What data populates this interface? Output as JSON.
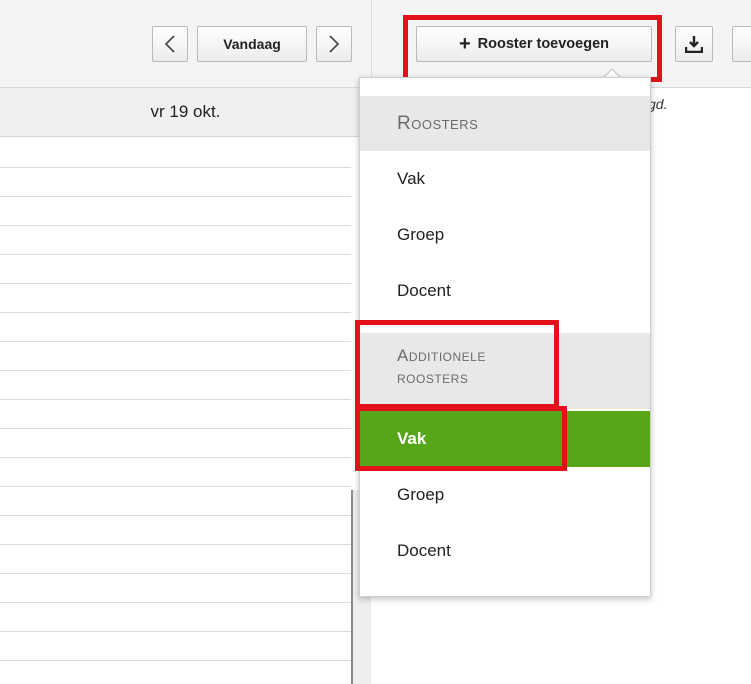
{
  "toolbar": {
    "prev_icon": "chevron-left-icon",
    "today_label": "Vandaag",
    "next_icon": "chevron-right-icon",
    "add_schedule_label": "Rooster toevoegen",
    "download_icon": "download-icon"
  },
  "calendar": {
    "day_header": "vr 19 okt.",
    "side_text_fragment": "gd."
  },
  "dropdown": {
    "section_roosters": "Roosters",
    "roosters_items": [
      "Vak",
      "Groep",
      "Docent"
    ],
    "section_additionele_line1": "Additionele",
    "section_additionele_line2": "roosters",
    "additionele_items": [
      "Vak",
      "Groep",
      "Docent"
    ],
    "selected_item": "Vak"
  },
  "colors": {
    "highlight": "#e3111b",
    "selected_item_bg": "#57a519"
  }
}
